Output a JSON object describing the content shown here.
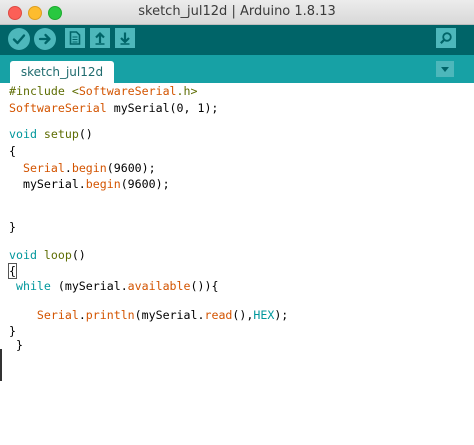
{
  "window": {
    "title": "sketch_jul12d | Arduino 1.8.13"
  },
  "toolbar": {
    "verify_icon": "checkmark-icon",
    "upload_icon": "right-arrow-icon",
    "new_icon": "new-file-icon",
    "open_icon": "up-arrow-icon",
    "save_icon": "down-arrow-icon",
    "serial_monitor_icon": "magnifier-icon"
  },
  "tabs": [
    {
      "label": "sketch_jul12d"
    }
  ],
  "tab_menu_icon": "triangle-down-icon",
  "code": {
    "l1": {
      "a": "#include <",
      "b": "SoftwareSerial",
      "c": ".h>"
    },
    "l2": {
      "a": "SoftwareSerial",
      "b": " mySerial(0, 1);"
    },
    "l3": {
      "a": "void",
      "b": " ",
      "c": "setup",
      "d": "()"
    },
    "l4": {
      "a": "{"
    },
    "l5": {
      "a": "  ",
      "b": "Serial",
      "c": ".",
      "d": "begin",
      "e": "(9600);"
    },
    "l6": {
      "a": "  mySerial.",
      "b": "begin",
      "c": "(9600);"
    },
    "l7": {
      "a": "}"
    },
    "l8": {
      "a": "void",
      "b": " ",
      "c": "loop",
      "d": "()"
    },
    "l9": {
      "a": "{"
    },
    "l10": {
      "a": " ",
      "b": "while",
      "c": " (mySerial.",
      "d": "available",
      "e": "()){"
    },
    "l11": {
      "a": "    ",
      "b": "Serial",
      "c": ".",
      "d": "println",
      "e": "(mySerial.",
      "f": "read",
      "g": "(),",
      "h": "HEX",
      "i": ");"
    },
    "l12": {
      "a": "}"
    },
    "l13": {
      "a": " }"
    }
  },
  "colors": {
    "toolbar": "#006468",
    "tabbar": "#17a1a5",
    "button": "#4db7bb",
    "keyword_blue": "#00979c",
    "keyword_orange": "#d35400",
    "keyword_green": "#5e6d03"
  }
}
